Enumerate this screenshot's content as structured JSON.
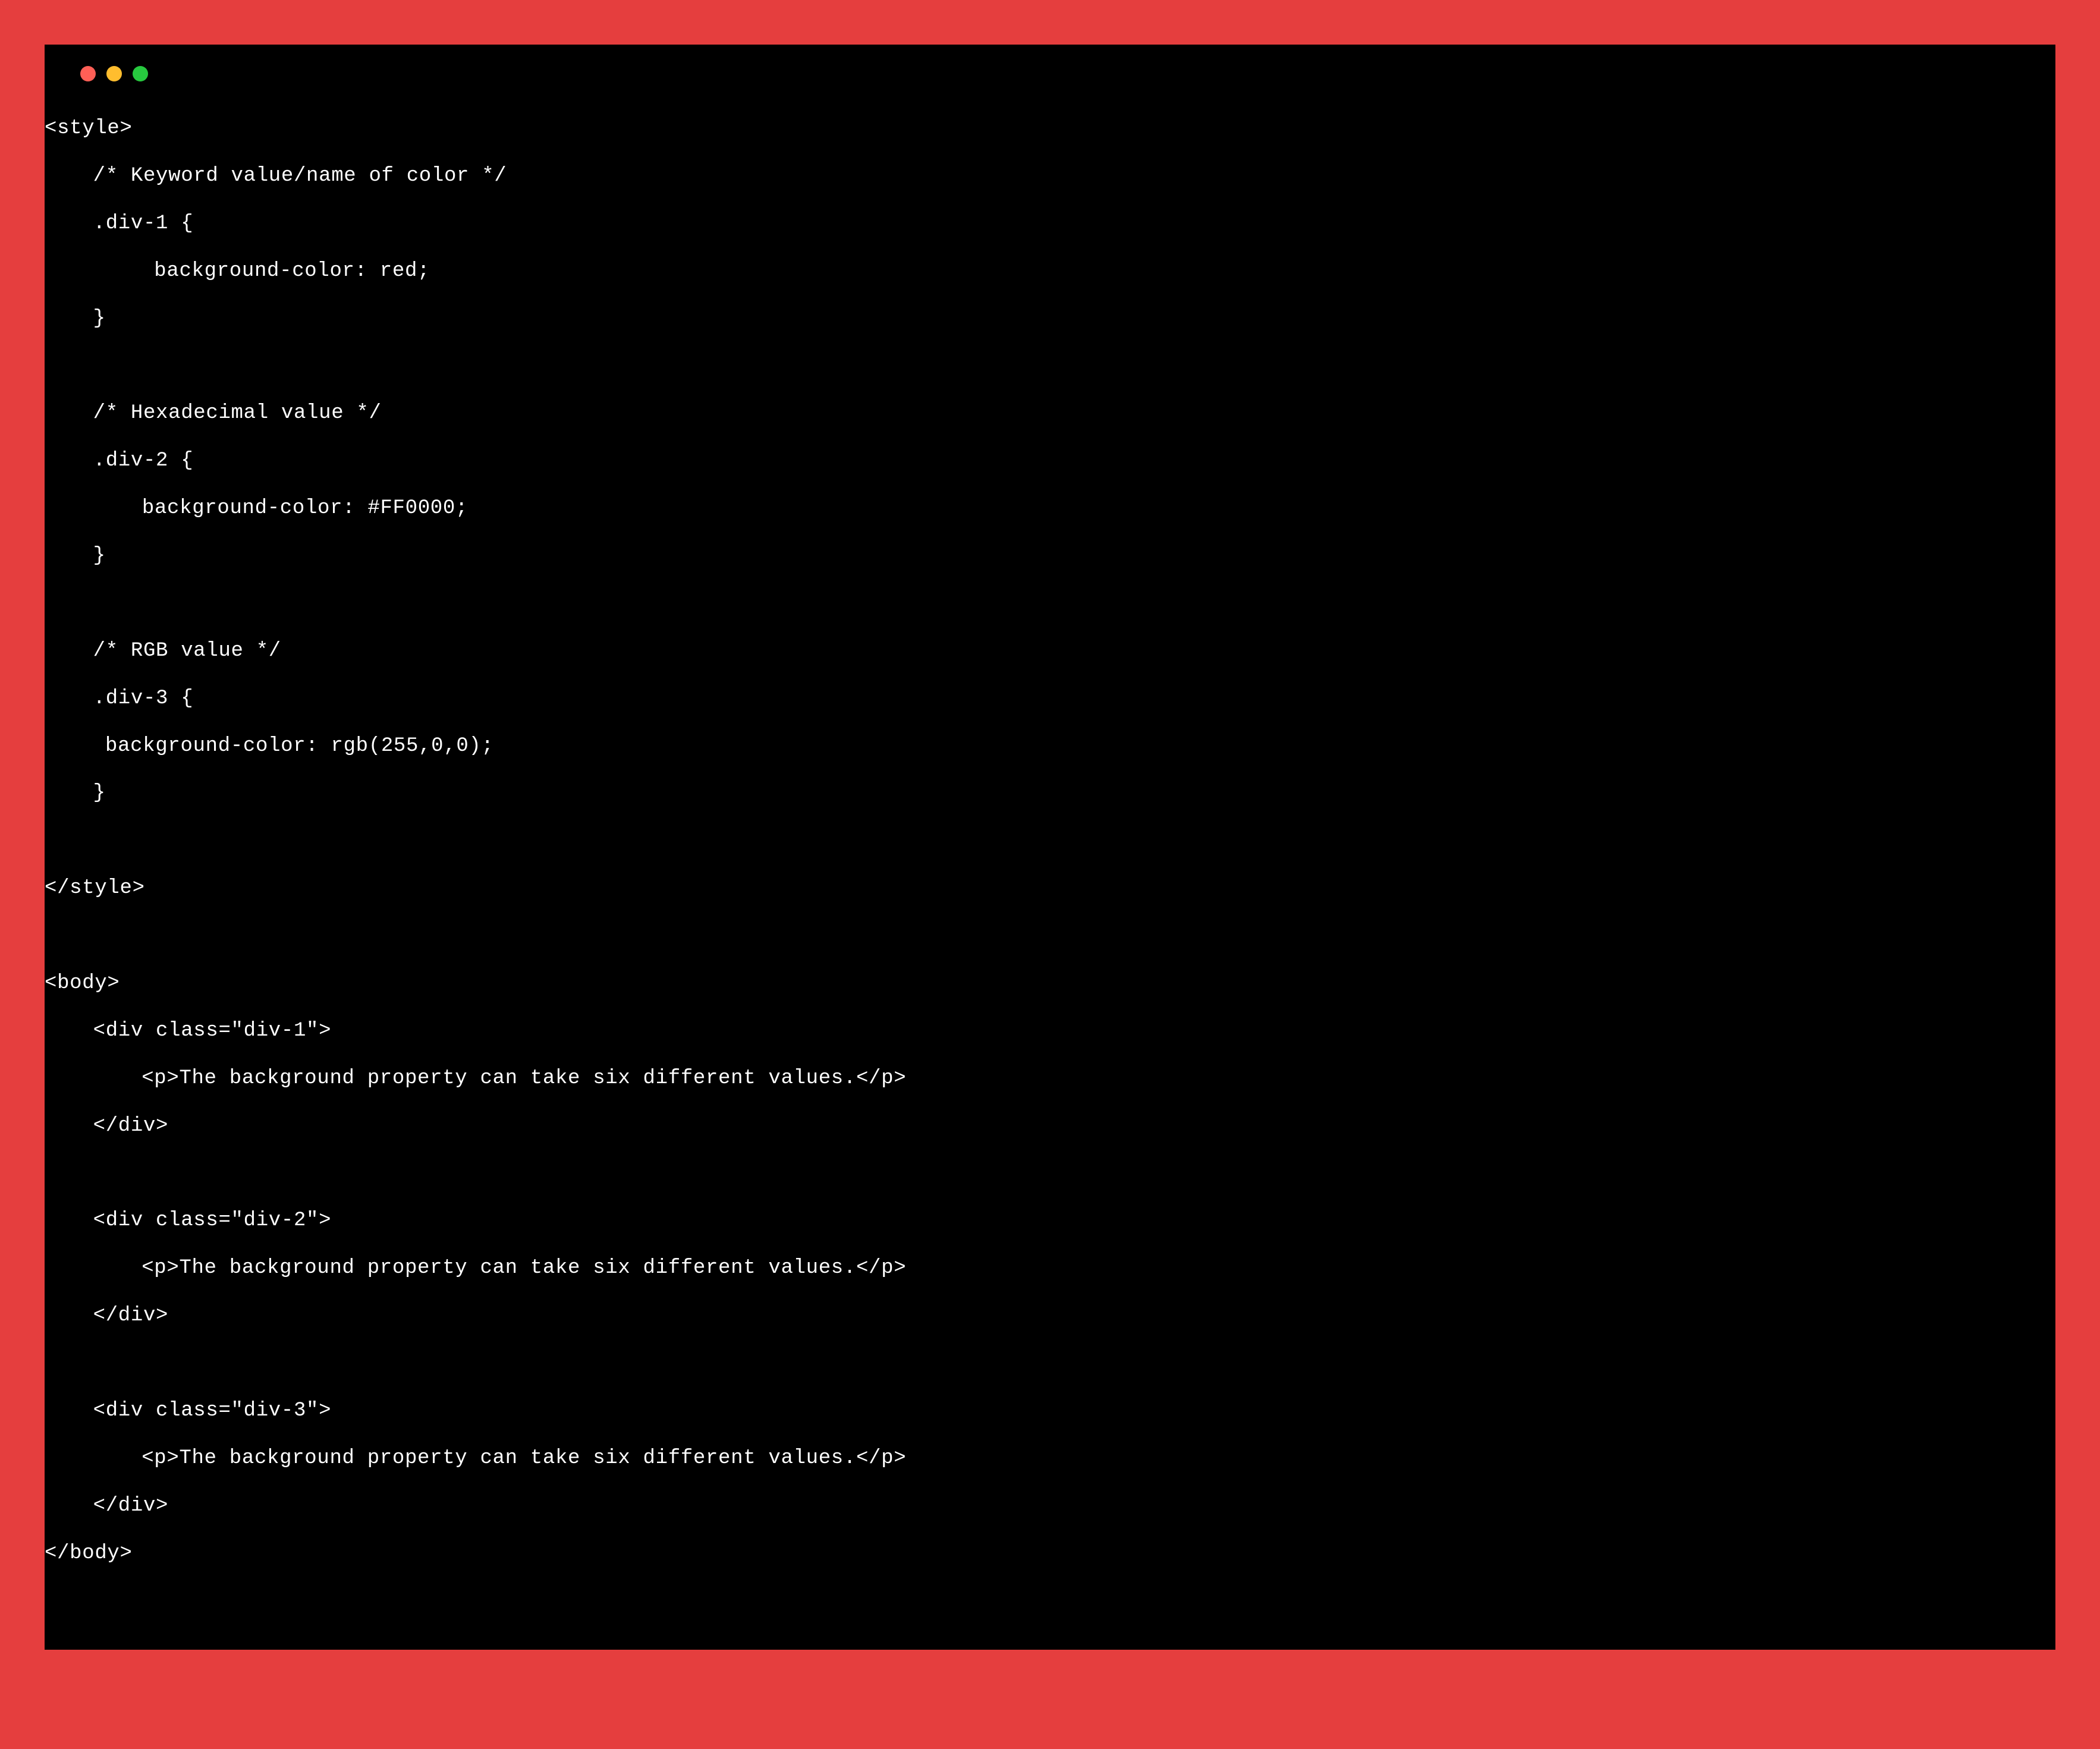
{
  "code": {
    "lines": [
      {
        "text": "<style>",
        "indent": ""
      },
      {
        "text": "/* Keyword value/name of color */",
        "indent": "indent-1"
      },
      {
        "text": ".div-1 {",
        "indent": "indent-1"
      },
      {
        "text": " background-color: red;",
        "indent": "indent-2"
      },
      {
        "text": "}",
        "indent": "indent-1"
      },
      {
        "text": "",
        "indent": "",
        "blank": true
      },
      {
        "text": "/* Hexadecimal value */",
        "indent": "indent-1"
      },
      {
        "text": ".div-2 {",
        "indent": "indent-1"
      },
      {
        "text": " background-color: #FF0000;",
        "indent": "indent-15"
      },
      {
        "text": "}",
        "indent": "indent-1"
      },
      {
        "text": "",
        "indent": "",
        "blank": true
      },
      {
        "text": "/* RGB value */",
        "indent": "indent-1"
      },
      {
        "text": ".div-3 {",
        "indent": "indent-1"
      },
      {
        "text": "background-color: rgb(255,0,0);",
        "indent": "indent-05"
      },
      {
        "text": "}",
        "indent": "indent-1"
      },
      {
        "text": "",
        "indent": "",
        "blank": true
      },
      {
        "text": "</style>",
        "indent": ""
      },
      {
        "text": "",
        "indent": "",
        "blank": true
      },
      {
        "text": "<body>",
        "indent": ""
      },
      {
        "text": "<div class=\"div-1\">",
        "indent": "indent-1"
      },
      {
        "text": "<p>The background property can take six different values.</p>",
        "indent": "indent-2"
      },
      {
        "text": "</div>",
        "indent": "indent-1"
      },
      {
        "text": "",
        "indent": "",
        "blank": true
      },
      {
        "text": "<div class=\"div-2\">",
        "indent": "indent-1"
      },
      {
        "text": "<p>The background property can take six different values.</p>",
        "indent": "indent-2"
      },
      {
        "text": "</div>",
        "indent": "indent-1"
      },
      {
        "text": "",
        "indent": "",
        "blank": true
      },
      {
        "text": "<div class=\"div-3\">",
        "indent": "indent-1"
      },
      {
        "text": "<p>The background property can take six different values.</p>",
        "indent": "indent-2"
      },
      {
        "text": "</div>",
        "indent": "indent-1"
      },
      {
        "text": "</body>",
        "indent": ""
      }
    ]
  },
  "colors": {
    "page_background": "#e53e3e",
    "terminal_background": "#000000",
    "text": "#ffffff",
    "traffic_red": "#ff5f56",
    "traffic_yellow": "#ffbd2e",
    "traffic_green": "#27c93f"
  }
}
